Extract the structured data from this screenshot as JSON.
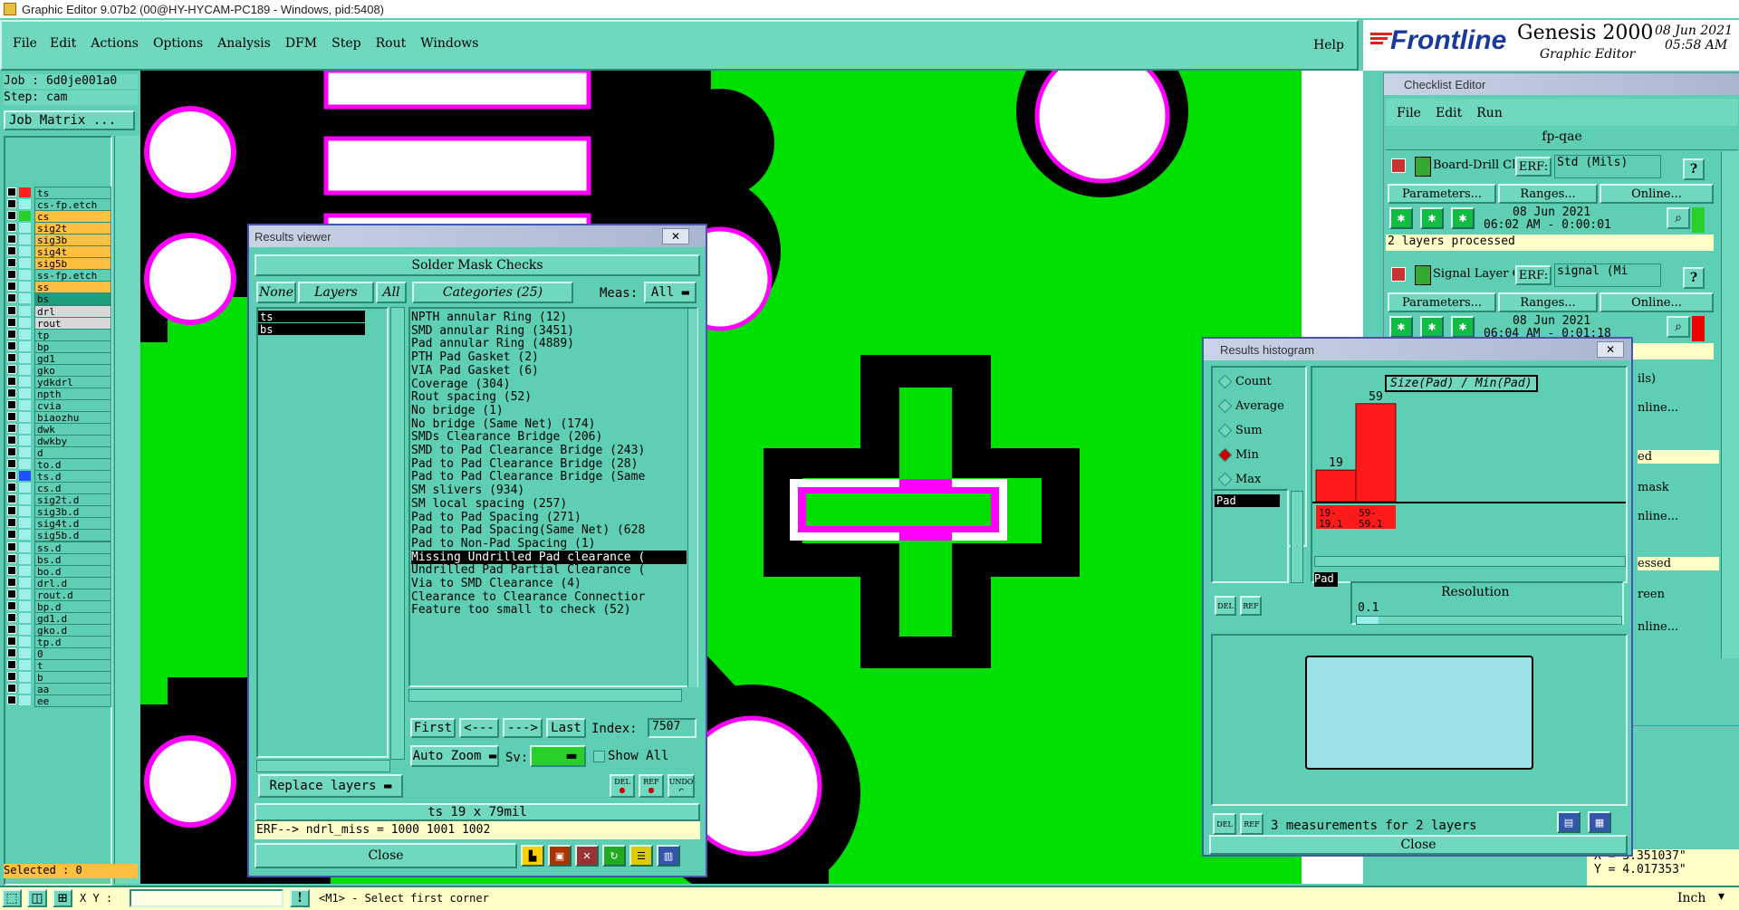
{
  "window_title": "Graphic Editor 9.07b2 (00@HY-HYCAM-PC189 - Windows, pid:5408)",
  "menu": [
    "File",
    "Edit",
    "Actions",
    "Options",
    "Analysis",
    "DFM",
    "Step",
    "Rout",
    "Windows"
  ],
  "help": "Help",
  "brand": {
    "logo": "Frontline",
    "product": "Genesis 2000",
    "subtitle": "Graphic Editor",
    "date": "08 Jun 2021",
    "time": "05:58 AM"
  },
  "job": {
    "job_label": "Job : 6d0je001a0",
    "step_label": "Step: cam",
    "matrix_button": "Job Matrix ..."
  },
  "layers": [
    {
      "name": "ts",
      "color": "#ff2020",
      "group": "ts"
    },
    {
      "name": "cs-fp.etch",
      "color": "#9ef0ea"
    },
    {
      "name": "cs",
      "color": "#2ad02a",
      "hl": "#ffbf40"
    },
    {
      "name": "sig2t",
      "color": "#9ef0ea",
      "hl": "#ffbf40"
    },
    {
      "name": "sig3b",
      "color": "#9ef0ea",
      "hl": "#ffbf40"
    },
    {
      "name": "sig4t",
      "color": "#9ef0ea",
      "hl": "#ffbf40"
    },
    {
      "name": "sig5b",
      "color": "#9ef0ea",
      "hl": "#ffbf40"
    },
    {
      "name": "ss-fp.etch",
      "color": "#9ef0ea"
    },
    {
      "name": "ss",
      "color": "#9ef0ea",
      "hl": "#ffbf40"
    },
    {
      "name": "bs",
      "color": "#9ef0ea",
      "hl": "#1f9e7c"
    },
    {
      "name": "drl",
      "color": "#9ef0ea",
      "hl": "#d8d8d8"
    },
    {
      "name": "rout",
      "color": "#9ef0ea",
      "hl": "#d8d8d8"
    },
    {
      "name": "tp"
    },
    {
      "name": "bp"
    },
    {
      "name": "gd1"
    },
    {
      "name": "gko"
    },
    {
      "name": "ydkdrl"
    },
    {
      "name": "npth"
    },
    {
      "name": "cvia"
    },
    {
      "name": "biaozhu"
    },
    {
      "name": "dwk"
    },
    {
      "name": "dwkby"
    },
    {
      "name": "d"
    },
    {
      "name": "to.d"
    },
    {
      "name": "ts.d",
      "color": "#2050ff"
    },
    {
      "name": "cs.d"
    },
    {
      "name": "sig2t.d"
    },
    {
      "name": "sig3b.d"
    },
    {
      "name": "sig4t.d"
    },
    {
      "name": "sig5b.d"
    },
    {
      "name": "ss.d"
    },
    {
      "name": "bs.d"
    },
    {
      "name": "bo.d"
    },
    {
      "name": "drl.d"
    },
    {
      "name": "rout.d"
    },
    {
      "name": "bp.d"
    },
    {
      "name": "gd1.d"
    },
    {
      "name": "gko.d"
    },
    {
      "name": "tp.d"
    },
    {
      "name": "0"
    },
    {
      "name": "t"
    },
    {
      "name": "b"
    },
    {
      "name": "aa"
    },
    {
      "name": "ee"
    }
  ],
  "selected": "Selected : 0",
  "status": {
    "xy_label": "X Y :",
    "message": "<M1> - Select first corner",
    "units": "Inch",
    "coord_x": "X = 3.351037\"",
    "coord_y": "Y = 4.017353\""
  },
  "results_viewer": {
    "title": "Results viewer",
    "header": "Solder Mask Checks",
    "none_btn": "None",
    "layers_btn": "Layers",
    "all_btn": "All",
    "categories_btn": "Categories (25)",
    "meas_label": "Meas:",
    "meas_value": "All",
    "layer_items": [
      "ts",
      "bs"
    ],
    "categories": [
      "NPTH annular Ring (12)",
      "SMD annular Ring (3451)",
      "Pad annular Ring (4889)",
      "PTH Pad Gasket (2)",
      "VIA Pad Gasket (6)",
      "Coverage (304)",
      "Rout spacing (52)",
      "No bridge (1)",
      "No bridge (Same Net) (174)",
      "SMDs Clearance Bridge (206)",
      "SMD to Pad Clearance Bridge (243)",
      "Pad to Pad Clearance Bridge (28)",
      "Pad to Pad Clearance Bridge (Same",
      "SM slivers (934)",
      "SM local spacing (257)",
      "Pad to Pad Spacing (271)",
      "Pad to Pad Spacing(Same Net) (628",
      "Pad to Non-Pad Spacing (1)",
      "Missing Undrilled Pad clearance (",
      "Undrilled Pad Partial Clearance (",
      "Via to SMD Clearance (4)",
      "Clearance to Clearance Connectior",
      "Feature too small to check (52)"
    ],
    "selected_index": 18,
    "first_btn": "First",
    "prev_btn": "<---",
    "next_btn": "--->",
    "last_btn": "Last",
    "index_label": "Index:",
    "index_value": "7507",
    "autozoom": "Auto Zoom",
    "sv_label": "Sv:",
    "show_all": "Show All",
    "replace_layers": "Replace layers",
    "info": "ts 19 x 79mil",
    "erf": "ERF--> ndrl_miss = 1000 1001 1002",
    "close": "Close",
    "del": "DEL",
    "ref": "REF",
    "undo": "UNDO"
  },
  "checklist": {
    "title": "Checklist Editor",
    "menu": [
      "File",
      "Edit",
      "Run"
    ],
    "name": "fp-qae",
    "rows": [
      {
        "name": "Board-Drill Che",
        "erf": "ERF:",
        "erf_value": "Std (Mils)",
        "date": "08 Jun 2021",
        "time": "06:02 AM - 0:00:01",
        "status": "2 layers processed"
      },
      {
        "name": "Signal Layer Ch",
        "erf": "ERF:",
        "erf_value": "signal (Mi",
        "date": "08 Jun 2021",
        "time": "06:04 AM - 0:01:18",
        "status": ""
      }
    ],
    "params": "Parameters...",
    "ranges": "Ranges...",
    "online": "Online...",
    "partial": [
      "ils)",
      "nline...",
      "ed",
      "mask",
      "nline...",
      "essed",
      "reen",
      "nline..."
    ]
  },
  "histogram": {
    "title": "Results histogram",
    "options": [
      "Count",
      "Average",
      "Sum",
      "Min",
      "Max"
    ],
    "selected_option": "Min",
    "measure_item": "Pad",
    "chart_title": "Size(Pad) / Min(Pad)",
    "bars": [
      {
        "value": 19,
        "label": "19-\n19.1"
      },
      {
        "value": 59,
        "label": "59-\n59.1"
      }
    ],
    "resolution_label": "Resolution",
    "resolution_value": "0.1",
    "pad_label": "Pad",
    "measurements": "3 measurements for 2 layers",
    "close": "Close"
  }
}
